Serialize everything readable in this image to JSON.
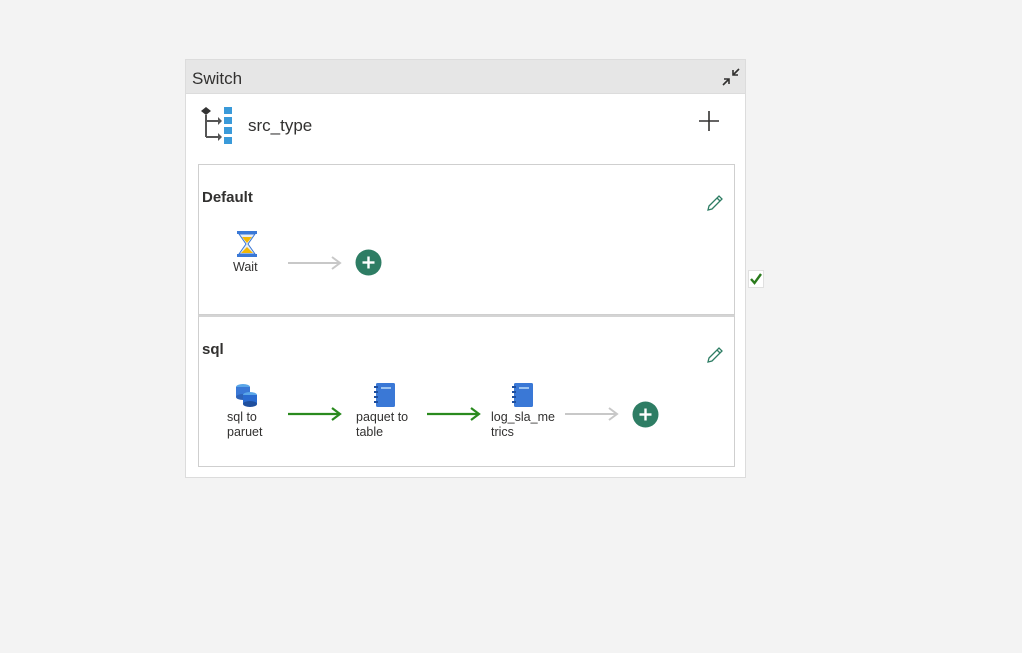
{
  "switch": {
    "title": "Switch",
    "expression": "src_type"
  },
  "cases": [
    {
      "name": "Default",
      "activities": [
        {
          "label": "Wait",
          "icon": "hourglass-icon"
        }
      ]
    },
    {
      "name": "sql",
      "activities": [
        {
          "label_line1": "sql to",
          "label_line2": "paruet",
          "icon": "database-icon"
        },
        {
          "label_line1": "paquet to",
          "label_line2": "table",
          "icon": "notebook-icon"
        },
        {
          "label_line1": "log_sla_me",
          "label_line2": "trics",
          "icon": "notebook-icon"
        }
      ]
    }
  ],
  "colors": {
    "success_arrow": "#2a8a1e",
    "pending_arrow": "#c8c8c8",
    "add_button": "#2e7d64",
    "notebook_blue": "#3a78d6",
    "edit_green": "#2e7d64"
  }
}
